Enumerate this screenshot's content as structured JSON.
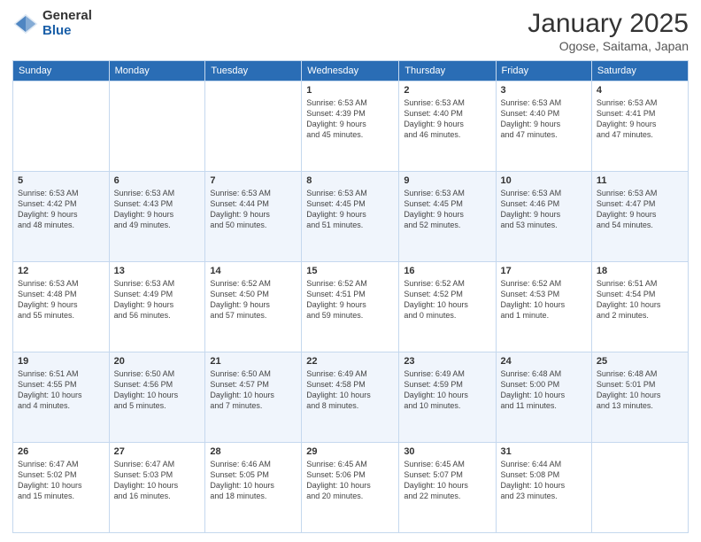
{
  "logo": {
    "general": "General",
    "blue": "Blue"
  },
  "header": {
    "month": "January 2025",
    "location": "Ogose, Saitama, Japan"
  },
  "weekdays": [
    "Sunday",
    "Monday",
    "Tuesday",
    "Wednesday",
    "Thursday",
    "Friday",
    "Saturday"
  ],
  "weeks": [
    [
      {
        "day": "",
        "info": ""
      },
      {
        "day": "",
        "info": ""
      },
      {
        "day": "",
        "info": ""
      },
      {
        "day": "1",
        "info": "Sunrise: 6:53 AM\nSunset: 4:39 PM\nDaylight: 9 hours\nand 45 minutes."
      },
      {
        "day": "2",
        "info": "Sunrise: 6:53 AM\nSunset: 4:40 PM\nDaylight: 9 hours\nand 46 minutes."
      },
      {
        "day": "3",
        "info": "Sunrise: 6:53 AM\nSunset: 4:40 PM\nDaylight: 9 hours\nand 47 minutes."
      },
      {
        "day": "4",
        "info": "Sunrise: 6:53 AM\nSunset: 4:41 PM\nDaylight: 9 hours\nand 47 minutes."
      }
    ],
    [
      {
        "day": "5",
        "info": "Sunrise: 6:53 AM\nSunset: 4:42 PM\nDaylight: 9 hours\nand 48 minutes."
      },
      {
        "day": "6",
        "info": "Sunrise: 6:53 AM\nSunset: 4:43 PM\nDaylight: 9 hours\nand 49 minutes."
      },
      {
        "day": "7",
        "info": "Sunrise: 6:53 AM\nSunset: 4:44 PM\nDaylight: 9 hours\nand 50 minutes."
      },
      {
        "day": "8",
        "info": "Sunrise: 6:53 AM\nSunset: 4:45 PM\nDaylight: 9 hours\nand 51 minutes."
      },
      {
        "day": "9",
        "info": "Sunrise: 6:53 AM\nSunset: 4:45 PM\nDaylight: 9 hours\nand 52 minutes."
      },
      {
        "day": "10",
        "info": "Sunrise: 6:53 AM\nSunset: 4:46 PM\nDaylight: 9 hours\nand 53 minutes."
      },
      {
        "day": "11",
        "info": "Sunrise: 6:53 AM\nSunset: 4:47 PM\nDaylight: 9 hours\nand 54 minutes."
      }
    ],
    [
      {
        "day": "12",
        "info": "Sunrise: 6:53 AM\nSunset: 4:48 PM\nDaylight: 9 hours\nand 55 minutes."
      },
      {
        "day": "13",
        "info": "Sunrise: 6:53 AM\nSunset: 4:49 PM\nDaylight: 9 hours\nand 56 minutes."
      },
      {
        "day": "14",
        "info": "Sunrise: 6:52 AM\nSunset: 4:50 PM\nDaylight: 9 hours\nand 57 minutes."
      },
      {
        "day": "15",
        "info": "Sunrise: 6:52 AM\nSunset: 4:51 PM\nDaylight: 9 hours\nand 59 minutes."
      },
      {
        "day": "16",
        "info": "Sunrise: 6:52 AM\nSunset: 4:52 PM\nDaylight: 10 hours\nand 0 minutes."
      },
      {
        "day": "17",
        "info": "Sunrise: 6:52 AM\nSunset: 4:53 PM\nDaylight: 10 hours\nand 1 minute."
      },
      {
        "day": "18",
        "info": "Sunrise: 6:51 AM\nSunset: 4:54 PM\nDaylight: 10 hours\nand 2 minutes."
      }
    ],
    [
      {
        "day": "19",
        "info": "Sunrise: 6:51 AM\nSunset: 4:55 PM\nDaylight: 10 hours\nand 4 minutes."
      },
      {
        "day": "20",
        "info": "Sunrise: 6:50 AM\nSunset: 4:56 PM\nDaylight: 10 hours\nand 5 minutes."
      },
      {
        "day": "21",
        "info": "Sunrise: 6:50 AM\nSunset: 4:57 PM\nDaylight: 10 hours\nand 7 minutes."
      },
      {
        "day": "22",
        "info": "Sunrise: 6:49 AM\nSunset: 4:58 PM\nDaylight: 10 hours\nand 8 minutes."
      },
      {
        "day": "23",
        "info": "Sunrise: 6:49 AM\nSunset: 4:59 PM\nDaylight: 10 hours\nand 10 minutes."
      },
      {
        "day": "24",
        "info": "Sunrise: 6:48 AM\nSunset: 5:00 PM\nDaylight: 10 hours\nand 11 minutes."
      },
      {
        "day": "25",
        "info": "Sunrise: 6:48 AM\nSunset: 5:01 PM\nDaylight: 10 hours\nand 13 minutes."
      }
    ],
    [
      {
        "day": "26",
        "info": "Sunrise: 6:47 AM\nSunset: 5:02 PM\nDaylight: 10 hours\nand 15 minutes."
      },
      {
        "day": "27",
        "info": "Sunrise: 6:47 AM\nSunset: 5:03 PM\nDaylight: 10 hours\nand 16 minutes."
      },
      {
        "day": "28",
        "info": "Sunrise: 6:46 AM\nSunset: 5:05 PM\nDaylight: 10 hours\nand 18 minutes."
      },
      {
        "day": "29",
        "info": "Sunrise: 6:45 AM\nSunset: 5:06 PM\nDaylight: 10 hours\nand 20 minutes."
      },
      {
        "day": "30",
        "info": "Sunrise: 6:45 AM\nSunset: 5:07 PM\nDaylight: 10 hours\nand 22 minutes."
      },
      {
        "day": "31",
        "info": "Sunrise: 6:44 AM\nSunset: 5:08 PM\nDaylight: 10 hours\nand 23 minutes."
      },
      {
        "day": "",
        "info": ""
      }
    ]
  ]
}
